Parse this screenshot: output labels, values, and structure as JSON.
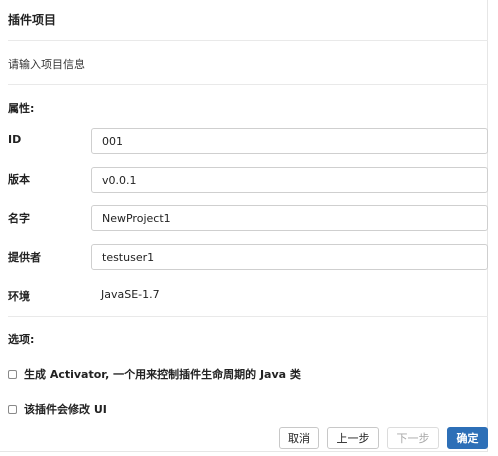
{
  "dialog": {
    "title": "插件项目",
    "subtitle": "请输入项目信息"
  },
  "properties": {
    "section_label": "属性:",
    "id": {
      "label": "ID",
      "value": "001"
    },
    "version": {
      "label": "版本",
      "value": "v0.0.1"
    },
    "name": {
      "label": "名字",
      "value": "NewProject1"
    },
    "provider": {
      "label": "提供者",
      "value": "testuser1"
    },
    "environment": {
      "label": "环境",
      "value": "JavaSE-1.7"
    }
  },
  "options": {
    "section_label": "选项:",
    "generate_activator": {
      "label": "生成 Activator, 一个用来控制插件生命周期的 Java 类",
      "checked": false
    },
    "modify_ui": {
      "label": "该插件会修改 UI",
      "checked": false
    }
  },
  "buttons": {
    "cancel": "取消",
    "previous": "上一步",
    "next": "下一步",
    "confirm": "确定"
  },
  "colors": {
    "primary": "#2d6fb7",
    "border": "#cfcfcf",
    "separator": "#e9e9e9"
  }
}
